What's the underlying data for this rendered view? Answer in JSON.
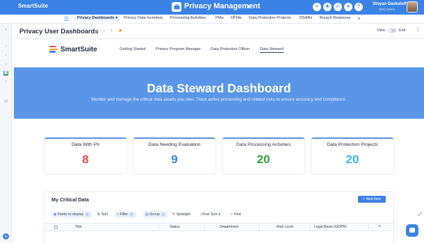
{
  "topbar": {
    "logo": "SmartSuite",
    "app_title": "Privacy Management",
    "user_name": "Stoyan Daskaloff",
    "user_org": "GRC Demo",
    "icons": [
      "search-icon",
      "star-icon",
      "check-icon",
      "bell-icon",
      "help-icon"
    ]
  },
  "tabs": [
    {
      "label": "Privacy Dashboards",
      "active": true
    },
    {
      "label": "Privacy Data Inventory"
    },
    {
      "label": "Processing Activities"
    },
    {
      "label": "PIAs"
    },
    {
      "label": "DPIAs"
    },
    {
      "label": "Data Protection Projects"
    },
    {
      "label": "DSARs"
    },
    {
      "label": "Breach Response"
    }
  ],
  "page": {
    "title": "Privacy User Dashboards",
    "view_label": "View",
    "edit_label": "Edit"
  },
  "nav": {
    "brand": "SmartSuite",
    "links": [
      "Getting Started",
      "Privacy Program Manager",
      "Data Protection Officer",
      "Data Steward"
    ],
    "active": "Data Steward"
  },
  "hero": {
    "title": "Data Steward Dashboard",
    "subtitle": "Monitor and manage the critical data assets you own. Track active processing and related risks to ensure accuracy and compliance."
  },
  "cards": [
    {
      "label": "Data With PII",
      "value": "8",
      "color": "#e8474b"
    },
    {
      "label": "Data Needing Evaluation",
      "value": "9",
      "color": "#3b82e6"
    },
    {
      "label": "Data Processing Activities",
      "value": "20",
      "color": "#2f9e44"
    },
    {
      "label": "Data Protection Projects",
      "value": "20",
      "color": "#3fb4ee"
    }
  ],
  "panel": {
    "title": "My Critical Data",
    "new_button": "+ New Item",
    "toolbar": {
      "fields": "Fields to display",
      "fields_count": "5",
      "sort": "Sort",
      "filter": "Filter",
      "filter_count": "2",
      "group": "Group",
      "group_count": "1",
      "spotlight": "Spotlight",
      "row_size": "Row Size",
      "find": "Find"
    },
    "columns": [
      "Title",
      "Status",
      "Department",
      "Risk Level",
      "Legal Basis (GDPR)"
    ]
  },
  "colors": {
    "accent": "#3b82e6",
    "hero": "#5b95e8",
    "active_sidebar": "#3b9b8f"
  }
}
